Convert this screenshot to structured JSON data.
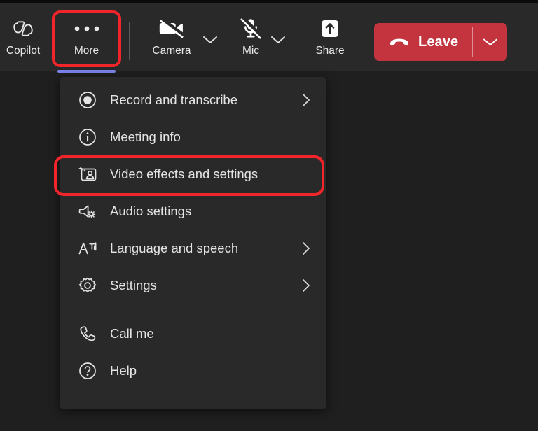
{
  "app": {
    "name": "Microsoft Teams meeting toolbar",
    "background_color": "#1f1f1f",
    "surface_color": "#292929",
    "accent_color": "#7b83eb",
    "leave_color": "#c4343f",
    "highlight_color": "#f2252b"
  },
  "toolbar": {
    "items": [
      {
        "label": "Copilot",
        "icon": "copilot-icon",
        "has_caret": false,
        "active": false
      },
      {
        "label": "More",
        "icon": "more-ellipsis-icon",
        "has_caret": false,
        "active": true
      },
      {
        "label": "Camera",
        "icon": "camera-off-icon",
        "has_caret": true,
        "active": false
      },
      {
        "label": "Mic",
        "icon": "mic-off-icon",
        "has_caret": true,
        "active": false
      },
      {
        "label": "Share",
        "icon": "share-screen-icon",
        "has_caret": false,
        "active": false
      }
    ],
    "leave": {
      "label": "Leave",
      "icon": "hang-up-phone-icon",
      "caret_icon": "chevron-down-icon"
    }
  },
  "menu": {
    "groups": [
      {
        "items": [
          {
            "label": "Record and transcribe",
            "icon": "record-circle-icon",
            "submenu": true
          },
          {
            "label": "Meeting info",
            "icon": "info-circle-icon",
            "submenu": false
          },
          {
            "label": "Video effects and settings",
            "icon": "video-effects-icon",
            "submenu": false,
            "highlighted": true
          },
          {
            "label": "Audio settings",
            "icon": "speaker-settings-icon",
            "submenu": false
          },
          {
            "label": "Language and speech",
            "icon": "language-translate-icon",
            "submenu": true
          },
          {
            "label": "Settings",
            "icon": "gear-icon",
            "submenu": true
          }
        ]
      },
      {
        "items": [
          {
            "label": "Call me",
            "icon": "phone-icon",
            "submenu": false
          },
          {
            "label": "Help",
            "icon": "help-circle-icon",
            "submenu": false
          }
        ]
      }
    ]
  },
  "annotations": [
    {
      "target": "More",
      "shape": "rounded-rectangle",
      "color": "#f2252b"
    },
    {
      "target": "Video effects and settings",
      "shape": "rounded-rectangle",
      "color": "#f2252b"
    }
  ]
}
